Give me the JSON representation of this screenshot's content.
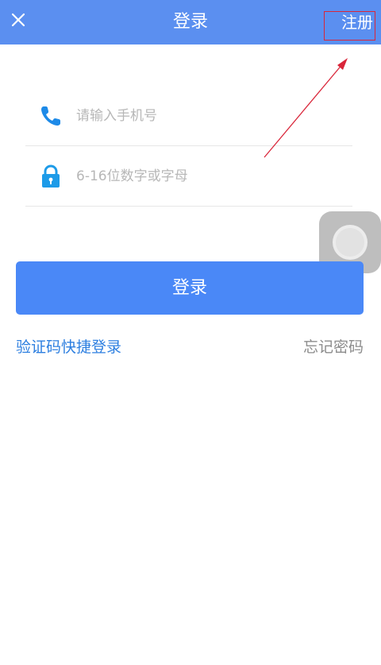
{
  "header": {
    "title": "登录",
    "close_icon": "close-icon",
    "register_label": "注册"
  },
  "form": {
    "phone_placeholder": "请输入手机号",
    "phone_icon": "phone-icon",
    "password_placeholder": "6-16位数字或字母",
    "password_icon": "lock-icon"
  },
  "actions": {
    "login_label": "登录",
    "sms_login_label": "验证码快捷登录",
    "forgot_password_label": "忘记密码"
  },
  "colors": {
    "header_bg": "#5b8ff0",
    "primary_button": "#4a88f7",
    "link_blue": "#2d7fe0",
    "icon_blue": "#1d8ae8",
    "annotation_red": "#d9263a"
  }
}
